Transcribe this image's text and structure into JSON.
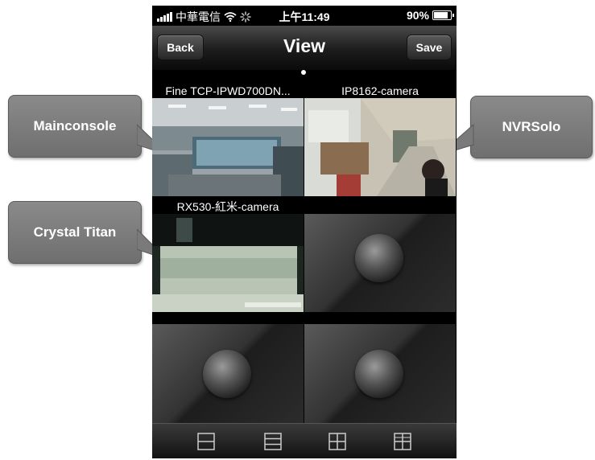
{
  "status": {
    "carrier": "中華電信",
    "time": "上午11:49",
    "battery": "90%"
  },
  "nav": {
    "back_label": "Back",
    "title": "View",
    "save_label": "Save"
  },
  "cameras": [
    {
      "name": "Fine TCP-IPWD700DN..."
    },
    {
      "name": "IP8162-camera"
    },
    {
      "name": "RX530-紅米-camera"
    },
    {
      "name": ""
    },
    {
      "name": ""
    },
    {
      "name": ""
    }
  ],
  "callouts": {
    "mainconsole": "Mainconsole",
    "nvrsolo": "NVRSolo",
    "crystal_titan": "Crystal Titan"
  },
  "toolbar": {
    "icons": [
      "layout-1x2-icon",
      "layout-1x3-icon",
      "layout-2x2-icon",
      "layout-3x3-icon"
    ]
  }
}
